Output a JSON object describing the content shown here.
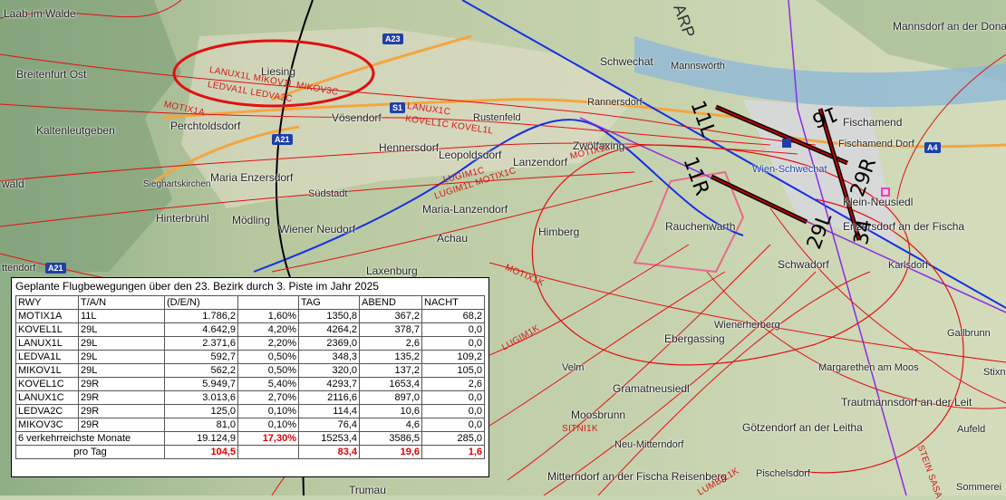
{
  "places": [
    {
      "id": "laab",
      "name": "Laab im Walde"
    },
    {
      "id": "breitenfurt",
      "name": "Breitenfurt Ost"
    },
    {
      "id": "kaltenleutgeben",
      "name": "Kaltenleutgeben"
    },
    {
      "id": "perchtoldsdorf",
      "name": "Perchtoldsdorf"
    },
    {
      "id": "liesing",
      "name": "Liesing"
    },
    {
      "id": "voesendorf",
      "name": "Vösendorf"
    },
    {
      "id": "maria-enzersdorf",
      "name": "Maria Enzersdorf"
    },
    {
      "id": "wald",
      "name": "wald"
    },
    {
      "id": "sieghartskirchen",
      "name": "Sieghartskirchen"
    },
    {
      "id": "hinterbruehl",
      "name": "Hinterbrühl"
    },
    {
      "id": "moedling",
      "name": "Mödling"
    },
    {
      "id": "wiener-neudorf",
      "name": "Wiener Neudorf"
    },
    {
      "id": "suedstadt",
      "name": "Südstadt"
    },
    {
      "id": "hennersdorf",
      "name": "Hennersdorf"
    },
    {
      "id": "leopoldsdorf",
      "name": "Leopoldsdorf"
    },
    {
      "id": "rustenfeld",
      "name": "Rustenfeld"
    },
    {
      "id": "schwechat",
      "name": "Schwechat"
    },
    {
      "id": "mannswoerth",
      "name": "Mannswörth"
    },
    {
      "id": "rannersdorf",
      "name": "Rannersdorf"
    },
    {
      "id": "zwoelfaxing",
      "name": "Zwölfaxing"
    },
    {
      "id": "lanzendorf",
      "name": "Lanzendorf"
    },
    {
      "id": "maria-lanzendorf",
      "name": "Maria-Lanzendorf"
    },
    {
      "id": "achau",
      "name": "Achau"
    },
    {
      "id": "himberg",
      "name": "Himberg"
    },
    {
      "id": "laxenburg",
      "name": "Laxenburg"
    },
    {
      "id": "trumau",
      "name": "Trumau"
    },
    {
      "id": "rauchenwarth",
      "name": "Rauchenwarth"
    },
    {
      "id": "schwadorf",
      "name": "Schwadorf"
    },
    {
      "id": "wien-schwechat",
      "name": "Wien-Schwechat"
    },
    {
      "id": "fischamend",
      "name": "Fischamend"
    },
    {
      "id": "fischamend-dorf",
      "name": "Fischamend Dorf"
    },
    {
      "id": "klein-neusiedl",
      "name": "Klein-Neusiedl"
    },
    {
      "id": "enzersdorf-fischa",
      "name": "Enzersdorf an der Fischa"
    },
    {
      "id": "karlsdorf",
      "name": "Karlsdorf"
    },
    {
      "id": "mannsdorf",
      "name": "Mannsdorf an der Donau"
    },
    {
      "id": "wienerherberg",
      "name": "Wienerherberg"
    },
    {
      "id": "ebergassing",
      "name": "Ebergassing"
    },
    {
      "id": "margarethen",
      "name": "Margarethen am Moos"
    },
    {
      "id": "gallbrunn",
      "name": "Gallbrunn"
    },
    {
      "id": "stixneusiedl",
      "name": "Stixn"
    },
    {
      "id": "velm",
      "name": "Velm"
    },
    {
      "id": "gramatneusiedl",
      "name": "Gramatneusiedl"
    },
    {
      "id": "moosbrunn",
      "name": "Moosbrunn"
    },
    {
      "id": "neu-mitterndorf",
      "name": "Neu-Mitterndorf"
    },
    {
      "id": "trautmannsdorf",
      "name": "Trautmannsdorf an der Leit"
    },
    {
      "id": "goetzendorf",
      "name": "Götzendorf an der Leitha"
    },
    {
      "id": "aufeld",
      "name": "Aufeld"
    },
    {
      "id": "mitterndorf",
      "name": "Mitterndorf an der Fischa Reisenberg"
    },
    {
      "id": "pischelsdorf",
      "name": "Pischelsdorf"
    },
    {
      "id": "sommerein",
      "name": "Sommerei"
    },
    {
      "id": "ttendorf",
      "name": "ttendorf"
    }
  ],
  "highways": [
    {
      "id": "a23",
      "label": "A23"
    },
    {
      "id": "s1",
      "label": "S1"
    },
    {
      "id": "a21",
      "label": "A21"
    },
    {
      "id": "a21b",
      "label": "A21"
    },
    {
      "id": "a4",
      "label": "A4"
    }
  ],
  "route_labels": [
    {
      "id": "lanux1l",
      "text": "LANUX1L  MIKOV1L  MIKOV3C"
    },
    {
      "id": "ledva1l",
      "text": "LEDVA1L  LEDVA2C"
    },
    {
      "id": "motix1a",
      "text": "MOTIX1A"
    },
    {
      "id": "lanux1c",
      "text": "LANUX1C"
    },
    {
      "id": "kovel1c",
      "text": "KOVEL1C  KOVEL1L"
    },
    {
      "id": "motix1l",
      "text": "MOTIX1L"
    },
    {
      "id": "lugim1c",
      "text": "LUGIM1C"
    },
    {
      "id": "lugim1l",
      "text": "LUGIM1L  MOTIX1C"
    },
    {
      "id": "motix1k",
      "text": "MOTIX1K"
    },
    {
      "id": "lugim1k",
      "text": "LUGIM1K"
    },
    {
      "id": "sitni1k",
      "text": "SITNI1K"
    },
    {
      "id": "lumbil1k",
      "text": "LUMBIL1K"
    },
    {
      "id": "steinsasa",
      "text": "STEIN SASA"
    },
    {
      "id": "arp",
      "text": "ARP"
    }
  ],
  "runways": [
    {
      "id": "r11l",
      "text": "11L"
    },
    {
      "id": "r11r",
      "text": "11R"
    },
    {
      "id": "r29l",
      "text": "29L"
    },
    {
      "id": "r29r",
      "text": "29R"
    },
    {
      "id": "r16",
      "text": "16"
    },
    {
      "id": "r34",
      "text": "34"
    }
  ],
  "table": {
    "title": "Geplante Flugbewegungen über den 23. Bezirk durch 3. Piste im Jahr 2025",
    "headers": [
      "RWY",
      "T/A/N",
      "(D/E/N)",
      "",
      "TAG",
      "ABEND",
      "NACHT"
    ],
    "rows": [
      [
        "MOTIX1A",
        "11L",
        "1.786,2",
        "1,60%",
        "1350,8",
        "367,2",
        "68,2"
      ],
      [
        "KOVEL1L",
        "29L",
        "4.642,9",
        "4,20%",
        "4264,2",
        "378,7",
        "0,0"
      ],
      [
        "LANUX1L",
        "29L",
        "2.371,6",
        "2,20%",
        "2369,0",
        "2,6",
        "0,0"
      ],
      [
        "LEDVA1L",
        "29L",
        "592,7",
        "0,50%",
        "348,3",
        "135,2",
        "109,2"
      ],
      [
        "MIKOV1L",
        "29L",
        "562,2",
        "0,50%",
        "320,0",
        "137,2",
        "105,0"
      ],
      [
        "KOVEL1C",
        "29R",
        "5.949,7",
        "5,40%",
        "4293,7",
        "1653,4",
        "2,6"
      ],
      [
        "LANUX1C",
        "29R",
        "3.013,6",
        "2,70%",
        "2116,6",
        "897,0",
        "0,0"
      ],
      [
        "LEDVA2C",
        "29R",
        "125,0",
        "0,10%",
        "114,4",
        "10,6",
        "0,0"
      ],
      [
        "MIKOV3C",
        "29R",
        "81,0",
        "0,10%",
        "76,4",
        "4,6",
        "0,0"
      ]
    ],
    "summary": [
      "6 verkehrreichste Monate",
      "19.124,9",
      "17,30%",
      "15253,4",
      "3586,5",
      "285,0"
    ],
    "perday": [
      "pro Tag",
      "104,5",
      "83,4",
      "19,6",
      "1,6"
    ]
  },
  "colors": {
    "route": "#e01010",
    "approach_blue": "#1530e0",
    "highlight_circle": "#e01010",
    "runway": "#000000",
    "heading_purple": "#8a2be2"
  }
}
